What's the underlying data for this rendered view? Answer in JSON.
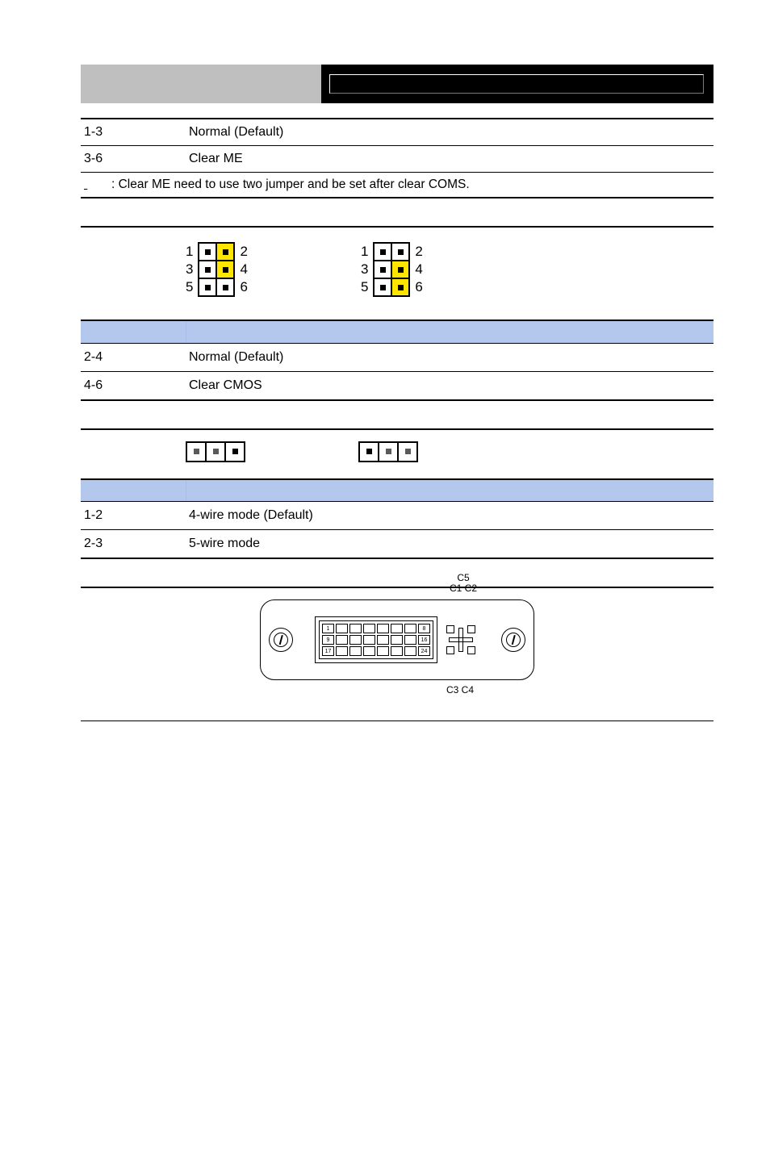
{
  "header": {},
  "table_me": {
    "rows": [
      {
        "pins": "1-3",
        "desc": "Normal (Default)"
      },
      {
        "pins": "3-6",
        "desc": "Clear ME"
      }
    ],
    "note_prefix_underline": "        ",
    "note": ": Clear ME need to use two jumper and be set after clear COMS."
  },
  "jumper6": {
    "left_labels": [
      "1",
      "3",
      "5"
    ],
    "right_labels": [
      "2",
      "4",
      "6"
    ],
    "configs": [
      {
        "hot": [
          1,
          2,
          3,
          4
        ]
      },
      {
        "hot": [
          3,
          4,
          5,
          6
        ]
      }
    ]
  },
  "blue_table1": {
    "rows": [
      {
        "pins": "2-4",
        "desc": "Normal (Default)"
      },
      {
        "pins": "4-6",
        "desc": "Clear CMOS"
      }
    ]
  },
  "jumper3": {
    "configs": [
      {
        "on": [
          1,
          2
        ]
      },
      {
        "on": [
          2,
          3
        ]
      }
    ]
  },
  "blue_table2": {
    "rows": [
      {
        "pins": "1-2",
        "desc": "4-wire mode (Default)"
      },
      {
        "pins": "2-3",
        "desc": "5-wire mode"
      }
    ]
  },
  "dvi": {
    "top_label_line1": "C5",
    "top_label_line2": "C1 C2",
    "bottom_label": "C3  C4",
    "col_right_labels": [
      "8",
      "16",
      "24"
    ],
    "col_left_labels": [
      "1",
      "9",
      "17"
    ]
  }
}
